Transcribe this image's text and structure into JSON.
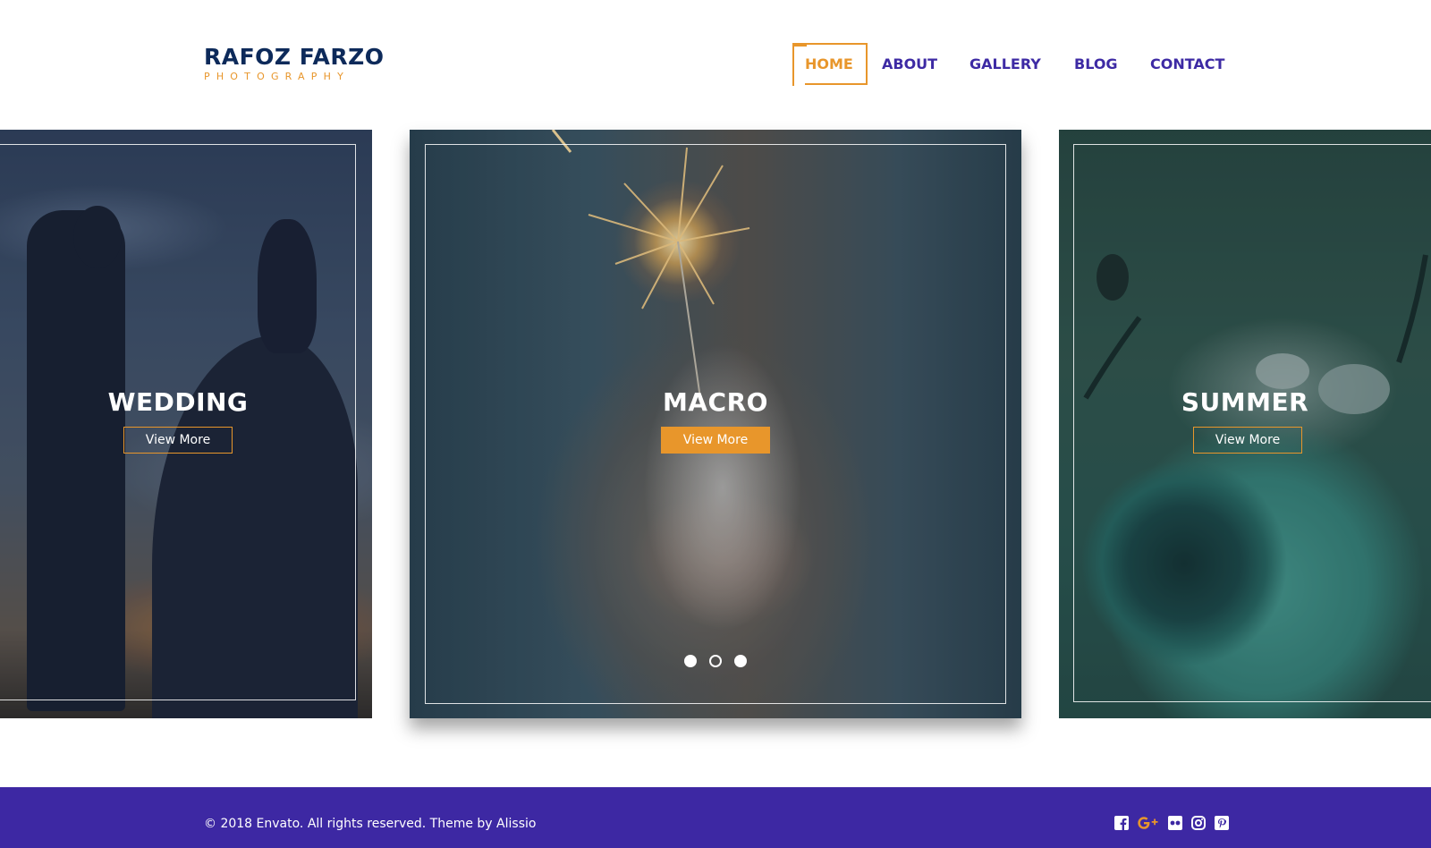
{
  "logo": {
    "title": "RAFOZ FARZO",
    "subtitle": "PHOTOGRAPHY"
  },
  "nav": {
    "items": [
      {
        "label": "HOME",
        "active": true
      },
      {
        "label": "ABOUT",
        "active": false
      },
      {
        "label": "GALLERY",
        "active": false
      },
      {
        "label": "BLOG",
        "active": false
      },
      {
        "label": "CONTACT",
        "active": false
      }
    ]
  },
  "slides": [
    {
      "title": "WEDDING",
      "button": "View More",
      "button_style": "outline"
    },
    {
      "title": "MACRO",
      "button": "View More",
      "button_style": "filled"
    },
    {
      "title": "SUMMER",
      "button": "View More",
      "button_style": "outline"
    }
  ],
  "carousel": {
    "dots": [
      {
        "state": "filled"
      },
      {
        "state": "ring"
      },
      {
        "state": "filled"
      }
    ]
  },
  "footer": {
    "copyright": "© 2018 Envato. All rights reserved. Theme by Alissio",
    "socials": [
      "facebook-icon",
      "google-plus-icon",
      "flickr-icon",
      "instagram-icon",
      "pinterest-icon"
    ]
  },
  "colors": {
    "brand_navy": "#0d2a5a",
    "accent_orange": "#e8962b",
    "nav_purple": "#3d2aa4",
    "footer_purple": "#3d28a3"
  }
}
